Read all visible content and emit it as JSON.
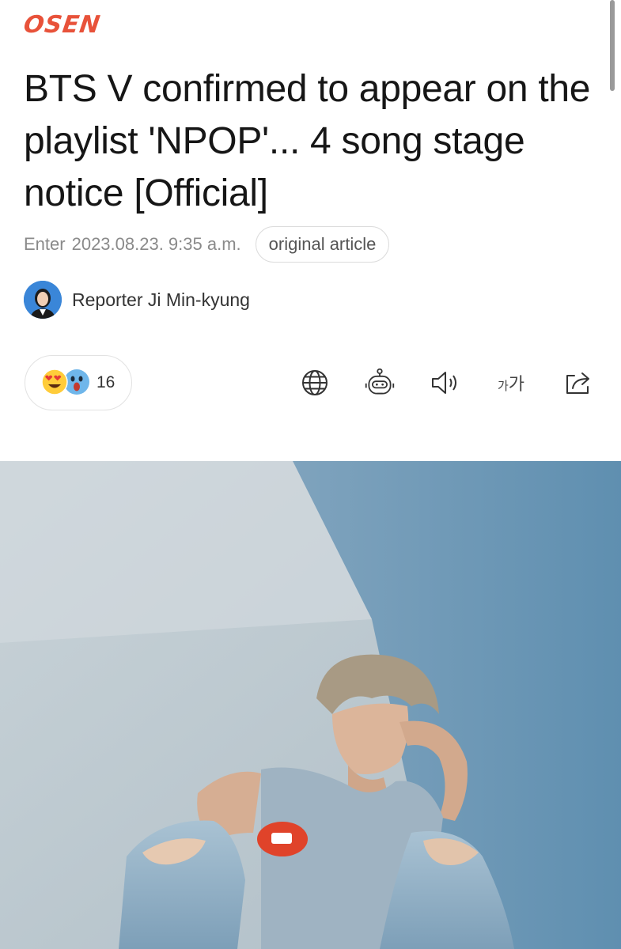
{
  "header": {
    "logo_text": "OSEN",
    "logo_color": "#e8523a"
  },
  "article": {
    "headline": "BTS V confirmed to appear on the playlist 'NPOP'... 4 song stage notice [Official]",
    "enter_label": "Enter",
    "date": "2023.08.23. 9:35 a.m.",
    "original_article_label": "original article",
    "reporter": "Reporter Ji Min-kyung"
  },
  "toolbar": {
    "reaction_count": "16",
    "icons": [
      "globe-icon",
      "robot-summary-icon",
      "speaker-icon",
      "font-size-icon",
      "share-icon"
    ],
    "font_size_small": "가",
    "font_size_large": "가"
  },
  "hero": {
    "image_description_tags": [
      "photo"
    ]
  },
  "colors": {
    "text": "#161616",
    "meta": "#8a8a8a",
    "border": "#dcdcdc"
  }
}
